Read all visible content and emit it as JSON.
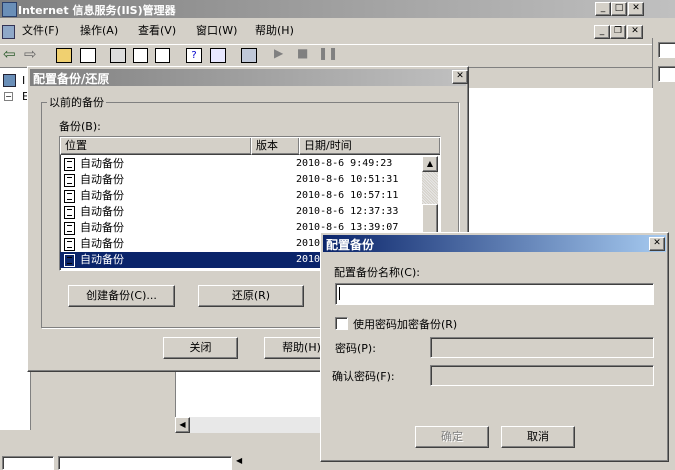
{
  "main_window": {
    "title": "Internet 信息服务(IIS)管理器",
    "menu": [
      "文件(F)",
      "操作(A)",
      "查看(V)",
      "窗口(W)",
      "帮助(H)"
    ],
    "tree_fragments": [
      "I",
      "E"
    ]
  },
  "backup_dialog": {
    "title": "配置备份/还原",
    "group_label": "以前的备份",
    "list_label": "备份(B):",
    "columns": [
      "位置",
      "版本",
      "日期/时间"
    ],
    "rows": [
      {
        "name": "自动备份",
        "version": "",
        "datetime": "2010-8-6 9:49:23"
      },
      {
        "name": "自动备份",
        "version": "",
        "datetime": "2010-8-6 10:51:31"
      },
      {
        "name": "自动备份",
        "version": "",
        "datetime": "2010-8-6 10:57:11"
      },
      {
        "name": "自动备份",
        "version": "",
        "datetime": "2010-8-6 12:37:33"
      },
      {
        "name": "自动备份",
        "version": "",
        "datetime": "2010-8-6 13:39:07"
      },
      {
        "name": "自动备份",
        "version": "",
        "datetime": "2010"
      },
      {
        "name": "自动备份",
        "version": "",
        "datetime": "2010"
      }
    ],
    "selected_index": 6,
    "create_button": "创建备份(C)...",
    "restore_button": "还原(R)",
    "close_button": "关闭",
    "help_button": "帮助(H)"
  },
  "config_dialog": {
    "title": "配置备份",
    "name_label": "配置备份名称(C):",
    "name_value": "",
    "encrypt_label": "使用密码加密备份(R)",
    "encrypt_checked": false,
    "password_label": "密码(P):",
    "confirm_label": "确认密码(F):",
    "ok_button": "确定",
    "cancel_button": "取消"
  },
  "colors": {
    "face": "#d4d0c8",
    "active_title": "#0a246a",
    "inactive_title": "#808080",
    "selection": "#0a246a"
  }
}
